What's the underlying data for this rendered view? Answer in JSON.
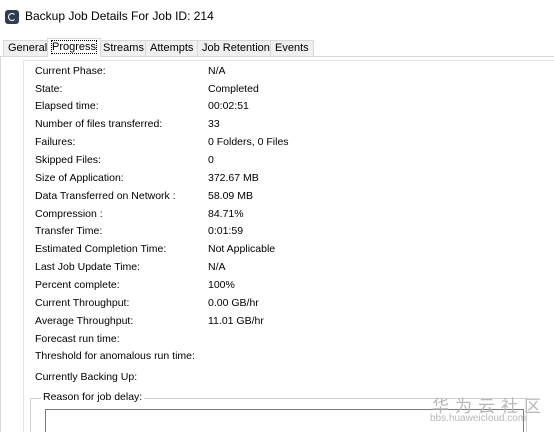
{
  "window": {
    "title": "Backup Job Details For Job ID: 214"
  },
  "tabs": [
    {
      "label": "General",
      "active": false
    },
    {
      "label": "Progress",
      "active": true
    },
    {
      "label": "Streams",
      "active": false
    },
    {
      "label": "Attempts",
      "active": false
    },
    {
      "label": "Job Retention",
      "active": false
    },
    {
      "label": "Events",
      "active": false
    }
  ],
  "progress": {
    "rows": [
      {
        "label": "Current Phase:",
        "value": "N/A"
      },
      {
        "label": "State:",
        "value": "Completed"
      },
      {
        "label": "Elapsed time:",
        "value": "00:02:51"
      },
      {
        "label": "Number of files transferred:",
        "value": "33"
      },
      {
        "label": "Failures:",
        "value": "0 Folders, 0 Files"
      },
      {
        "label": "Skipped Files:",
        "value": "0"
      },
      {
        "label": "Size of Application:",
        "value": "372.67 MB"
      },
      {
        "label": "Data Transferred on Network :",
        "value": "58.09 MB"
      },
      {
        "label": "Compression :",
        "value": "84.71%"
      },
      {
        "label": "Transfer Time:",
        "value": "0:01:59"
      },
      {
        "label": "Estimated Completion Time:",
        "value": "Not Applicable"
      },
      {
        "label": "Last Job Update Time:",
        "value": "N/A"
      },
      {
        "label": "Percent complete:",
        "value": "100%"
      },
      {
        "label": "Current Throughput:",
        "value": "0.00 GB/hr"
      },
      {
        "label": "Average Throughput:",
        "value": "11.01 GB/hr"
      },
      {
        "label": "Forecast run time:",
        "value": ""
      },
      {
        "label": "Threshold for anomalous run time:",
        "value": ""
      }
    ],
    "currently_backing_up_label": "Currently Backing Up:",
    "reason_for_delay_label": "Reason for job delay:"
  },
  "watermark": {
    "text": "华为云社区",
    "url": "bbs.huaweicloud.com"
  },
  "colors": {
    "tab_border": "#d9d9d9",
    "tab_inactive_bg": "#f0f0f0",
    "watermark": "#b8b8b8"
  }
}
